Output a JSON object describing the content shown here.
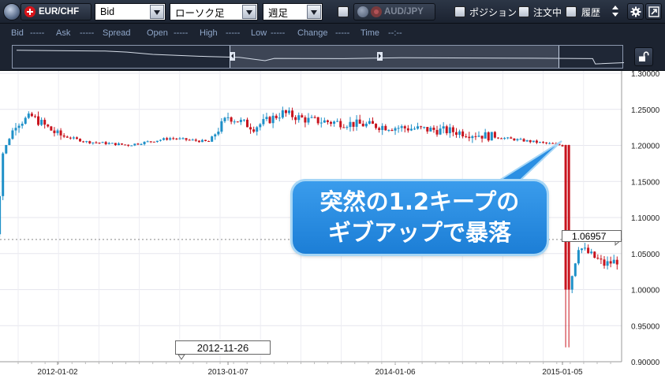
{
  "toolbar": {
    "symbol": "EUR/CHF",
    "price_type": "Bid",
    "chart_type": "ローソク足",
    "period": "週足",
    "compare_symbol": "AUD/JPY",
    "position_label": "ポジション",
    "order_label": "注文中",
    "history_label": "履歴"
  },
  "info": {
    "bid_label": "Bid",
    "bid_value": "-----",
    "ask_label": "Ask",
    "ask_value": "-----",
    "spread_label": "Spread",
    "spread_value": "",
    "open_label": "Open",
    "open_value": "-----",
    "high_label": "High",
    "high_value": "-----",
    "low_label": "Low",
    "low_value": "-----",
    "change_label": "Change",
    "change_value": "-----",
    "time_label": "Time",
    "time_value": "--:--"
  },
  "chart": {
    "y_ticks": [
      "1.30000",
      "1.25000",
      "1.20000",
      "1.15000",
      "1.10000",
      "1.05000",
      "1.00000",
      "0.95000",
      "0.90000"
    ],
    "x_ticks": [
      "2012-01-02",
      "2013-01-07",
      "2014-01-06",
      "2015-01-05"
    ],
    "current_price": "1.06957",
    "cursor_date": "2012-11-26",
    "annotation_line1": "突然の1.2キープの",
    "annotation_line2": "ギブアップで暴落",
    "up_color": "#1e90c8",
    "down_color": "#c8141e"
  },
  "chart_data": {
    "type": "candlestick",
    "title": "",
    "ylim": [
      0.9,
      1.3
    ],
    "current_price": 1.06957,
    "close_path": [
      {
        "date": "2011-08-08",
        "close": 1.15
      },
      {
        "date": "2011-08-22",
        "close": 1.08
      },
      {
        "date": "2011-09-05",
        "close": 1.19
      },
      {
        "date": "2011-10-03",
        "close": 1.23
      },
      {
        "date": "2011-11-07",
        "close": 1.24
      },
      {
        "date": "2012-01-02",
        "close": 1.215
      },
      {
        "date": "2012-03-05",
        "close": 1.205
      },
      {
        "date": "2012-06-04",
        "close": 1.2005
      },
      {
        "date": "2012-09-03",
        "close": 1.21
      },
      {
        "date": "2012-11-26",
        "close": 1.205
      },
      {
        "date": "2013-01-07",
        "close": 1.24
      },
      {
        "date": "2013-03-04",
        "close": 1.225
      },
      {
        "date": "2013-05-06",
        "close": 1.245
      },
      {
        "date": "2013-07-01",
        "close": 1.235
      },
      {
        "date": "2013-10-07",
        "close": 1.23
      },
      {
        "date": "2014-01-06",
        "close": 1.225
      },
      {
        "date": "2014-05-05",
        "close": 1.22
      },
      {
        "date": "2014-09-01",
        "close": 1.21
      },
      {
        "date": "2015-01-05",
        "close": 1.2
      },
      {
        "date": "2015-01-15",
        "close": 0.99
      },
      {
        "date": "2015-02-09",
        "close": 1.06
      },
      {
        "date": "2015-04-06",
        "close": 1.035
      },
      {
        "date": "2015-05-04",
        "close": 1.04
      }
    ],
    "notable": {
      "date": "2015-01-15",
      "low": 0.92
    }
  }
}
